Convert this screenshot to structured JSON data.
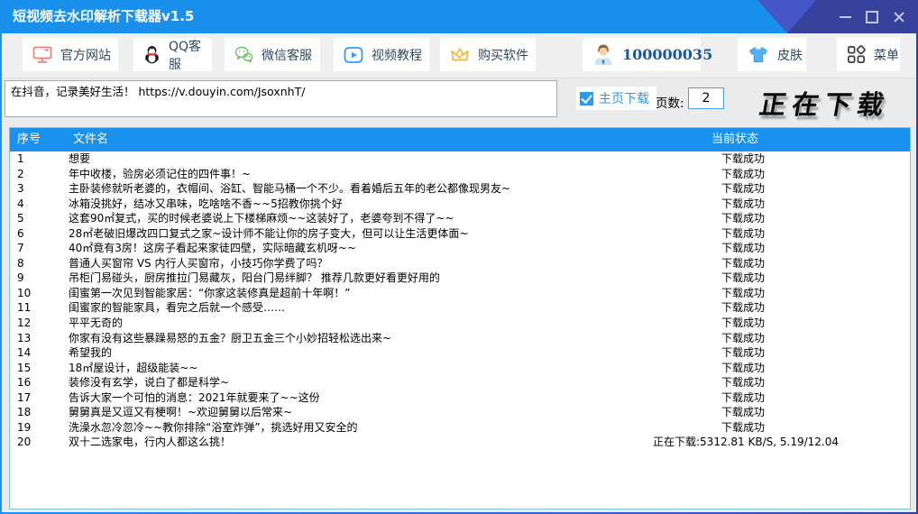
{
  "window": {
    "title": "短视频去水印解析下载器v1.5"
  },
  "colors": {
    "titlebar_blue": "#1890ec",
    "titlebar_dark_blue": "#36419b",
    "titlebar_mid_blue": "#4656c6",
    "table_header_blue": "#1892ec",
    "checkbox_blue": "#2b9bf0",
    "account_text_blue": "#15589c",
    "button_text": "#31495e"
  },
  "icons": {
    "official_site": "monitor-icon",
    "qq_support": "qq-penguin-icon",
    "wechat_support": "wechat-icon",
    "video_tutorial": "video-play-icon",
    "buy_software": "crown-icon",
    "account": "person-avatar-icon",
    "skin": "tshirt-icon",
    "menu": "grid-menu-icon"
  },
  "toolbar": {
    "official_site": "官方网站",
    "qq_support": "QQ客服",
    "wechat_support": "微信客服",
    "video_tutorial": "视频教程",
    "buy_software": "购买软件",
    "account_id": "100000035",
    "skin": "皮肤",
    "menu": "菜单"
  },
  "url_panel": {
    "input_value": "在抖音，记录美好生活！ https://v.douyin.com/JsoxnhT/",
    "homepage_download_label": "主页下载",
    "homepage_download_checked": true,
    "pages_label": "页数:",
    "pages_value": "2",
    "downloading_banner": "正在下载"
  },
  "table": {
    "headers": {
      "index": "序号",
      "filename": "文件名",
      "status": "当前状态"
    },
    "rows": [
      {
        "no": "1",
        "filename": "想要",
        "status": "下载成功"
      },
      {
        "no": "2",
        "filename": "年中收楼，验房必须记住的四件事！~",
        "status": "下载成功"
      },
      {
        "no": "3",
        "filename": "主卧装修就听老婆的，衣帽间、浴缸、智能马桶一个不少。看着婚后五年的老公都像现男友~",
        "status": "下载成功"
      },
      {
        "no": "4",
        "filename": "冰箱没挑好，结冰又串味，吃啥啥不香~~5招教你挑个好",
        "status": "下载成功"
      },
      {
        "no": "5",
        "filename": "这套90㎡复式，买的时候老婆说上下楼梯麻烦~~这装好了，老婆夸到不得了~~",
        "status": "下载成功"
      },
      {
        "no": "6",
        "filename": "28㎡老破旧爆改四口复式之家~设计师不能让你的房子变大，但可以让生活更体面~",
        "status": "下载成功"
      },
      {
        "no": "7",
        "filename": "40㎡竟有3房！这房子看起来家徒四壁，实际暗藏玄机呀~~",
        "status": "下载成功"
      },
      {
        "no": "8",
        "filename": "普通人买窗帘 VS 内行人买窗帘，小技巧你学费了吗？",
        "status": "下载成功"
      },
      {
        "no": "9",
        "filename": "吊柜门易碰头，厨房推拉门易藏灰，阳台门易绊脚？ 推荐几款更好看更好用的",
        "status": "下载成功"
      },
      {
        "no": "10",
        "filename": "闺蜜第一次见到智能家居：“你家这装修真是超前十年啊！”",
        "status": "下载成功"
      },
      {
        "no": "11",
        "filename": "闺蜜家的智能家具，看完之后就一个感受……",
        "status": "下载成功"
      },
      {
        "no": "12",
        "filename": "平平无奇的",
        "status": "下载成功"
      },
      {
        "no": "13",
        "filename": "你家有没有这些暴躁易怒的五金？厨卫五金三个小妙招轻松选出来~",
        "status": "下载成功"
      },
      {
        "no": "14",
        "filename": "希望我的",
        "status": "下载成功"
      },
      {
        "no": "15",
        "filename": "18㎡屋设计，超级能装~~",
        "status": "下载成功"
      },
      {
        "no": "16",
        "filename": "装修没有玄学，说白了都是科学~",
        "status": "下载成功"
      },
      {
        "no": "17",
        "filename": "告诉大家一个可怕的消息：2021年就要来了~~这份",
        "status": "下载成功"
      },
      {
        "no": "18",
        "filename": "舅舅真是又逗又有梗啊！~欢迎舅舅以后常来~",
        "status": "下载成功"
      },
      {
        "no": "19",
        "filename": "洗澡水忽冷忽冷~~教你排除“浴室炸弹”，挑选好用又安全的",
        "status": "下载成功"
      },
      {
        "no": "20",
        "filename": "双十二选家电，行内人都这么挑！",
        "status": "正在下载:5312.81 KB/S, 5.19/12.04"
      }
    ]
  }
}
